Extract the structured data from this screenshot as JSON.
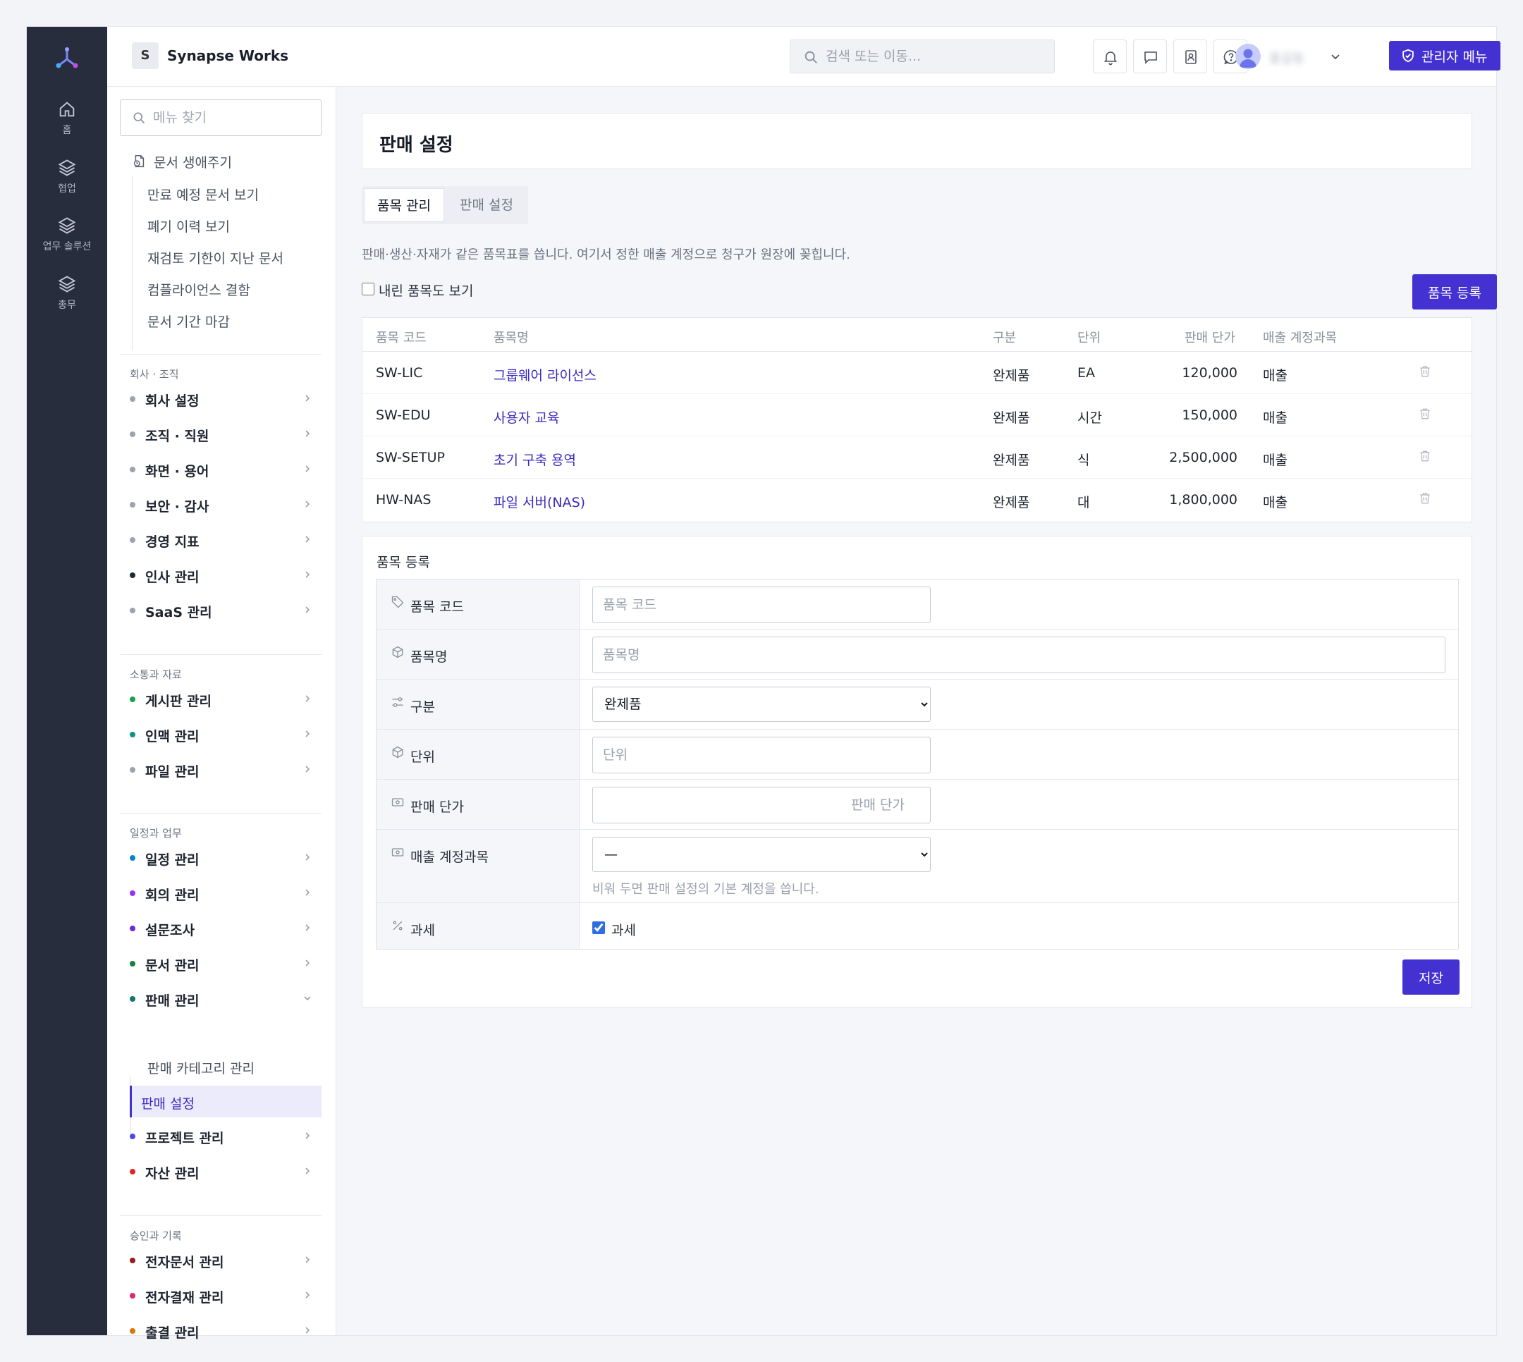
{
  "app": {
    "org_initial": "S",
    "org_name": "Synapse Works",
    "accent_color": "#4431d1"
  },
  "rail": {
    "items": [
      {
        "label": "홈",
        "icon": "home-icon"
      },
      {
        "label": "협업",
        "icon": "layers-icon"
      },
      {
        "label": "업무 솔루션",
        "icon": "layers-icon"
      },
      {
        "label": "총무",
        "icon": "layers-icon"
      }
    ]
  },
  "topbar": {
    "search_placeholder": "검색 또는 이동...",
    "icons": [
      "bell-icon",
      "message-icon",
      "contacts-icon",
      "help-icon"
    ],
    "user_name": "홍길동",
    "admin_label": "관리자 메뉴"
  },
  "sidebar": {
    "search_placeholder": "메뉴 찾기",
    "lifecycle": {
      "title": "문서 생애주기",
      "items": [
        "만료 예정 문서 보기",
        "폐기 이력 보기",
        "재검토 기한이 지난 문서",
        "컴플라이언스 결함",
        "문서 기간 마감"
      ]
    },
    "sections": [
      {
        "title": "회사 · 조직",
        "items": [
          {
            "label": "회사 설정",
            "dot": "#9ca3af"
          },
          {
            "label": "조직 · 직원",
            "dot": "#9ca3af"
          },
          {
            "label": "화면 · 용어",
            "dot": "#9ca3af"
          },
          {
            "label": "보안 · 감사",
            "dot": "#9ca3af"
          },
          {
            "label": "경영 지표",
            "dot": "#9ca3af"
          },
          {
            "label": "인사 관리",
            "dot": "#1f2937"
          },
          {
            "label": "SaaS 관리",
            "dot": "#9ca3af"
          }
        ]
      },
      {
        "title": "소통과 자료",
        "items": [
          {
            "label": "게시판 관리",
            "dot": "#16a34a"
          },
          {
            "label": "인맥 관리",
            "dot": "#0d9488"
          },
          {
            "label": "파일 관리",
            "dot": "#9ca3af"
          }
        ]
      },
      {
        "title": "일정과 업무",
        "items": [
          {
            "label": "일정 관리",
            "dot": "#0284c7"
          },
          {
            "label": "회의 관리",
            "dot": "#9333ea"
          },
          {
            "label": "설문조사",
            "dot": "#6d28d9"
          },
          {
            "label": "문서 관리",
            "dot": "#15803d"
          },
          {
            "label": "판매 관리",
            "dot": "#0f766e",
            "sub": [
              "판매 카테고리 관리",
              "판매 설정"
            ]
          },
          {
            "label": "프로젝트 관리",
            "dot": "#4f46e5"
          },
          {
            "label": "자산 관리",
            "dot": "#dc2626"
          }
        ]
      },
      {
        "title": "승인과 기록",
        "items": [
          {
            "label": "전자문서 관리",
            "dot": "#991b1b"
          },
          {
            "label": "전자결재 관리",
            "dot": "#db2777"
          },
          {
            "label": "출결 관리",
            "dot": "#d97706"
          }
        ]
      }
    ]
  },
  "main": {
    "title": "판매 설정",
    "tabs": [
      "품목 관리",
      "판매 설정"
    ],
    "description": "판매·생산·자재가 같은 품목표를 씁니다. 여기서 정한 매출 계정으로 청구가 원장에 꽂힙니다.",
    "show_inactive_label": "내린 품목도 보기",
    "register_button": "품목 등록",
    "table": {
      "headers": [
        "품목 코드",
        "품목명",
        "구분",
        "단위",
        "판매 단가",
        "매출 계정과목"
      ],
      "rows": [
        [
          "SW-LIC",
          "그룹웨어 라이선스",
          "완제품",
          "EA",
          "120,000",
          "매출"
        ],
        [
          "SW-EDU",
          "사용자 교육",
          "완제품",
          "시간",
          "150,000",
          "매출"
        ],
        [
          "SW-SETUP",
          "초기 구축 용역",
          "완제품",
          "식",
          "2,500,000",
          "매출"
        ],
        [
          "HW-NAS",
          "파일 서버(NAS)",
          "완제품",
          "대",
          "1,800,000",
          "매출"
        ]
      ]
    },
    "form": {
      "title": "품목 등록",
      "code_label": "품목 코드",
      "code_placeholder": "품목 코드",
      "name_label": "품목명",
      "name_placeholder": "품목명",
      "type_label": "구분",
      "type_value": "완제품",
      "unit_label": "단위",
      "unit_placeholder": "단위",
      "price_label": "판매 단가",
      "price_placeholder": "판매 단가",
      "account_label": "매출 계정과목",
      "account_value": "—",
      "account_hint": "비워 두면 판매 설정의 기본 계정을 씁니다.",
      "tax_label": "과세",
      "tax_check_label": "과세",
      "save_button": "저장"
    }
  }
}
